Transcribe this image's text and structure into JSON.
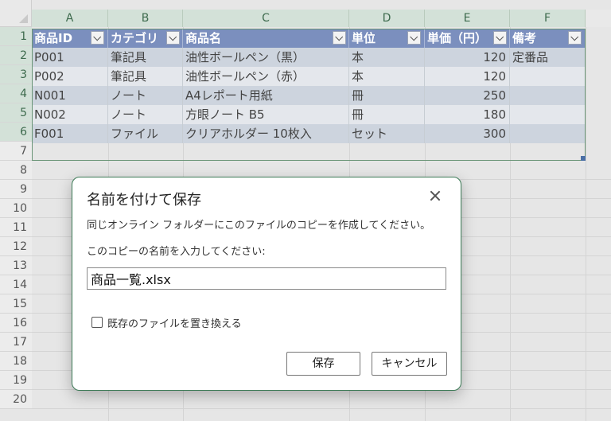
{
  "columns": [
    "A",
    "B",
    "C",
    "D",
    "E",
    "F"
  ],
  "rows": [
    "1",
    "2",
    "3",
    "4",
    "5",
    "6",
    "7",
    "8",
    "9",
    "10",
    "11",
    "12",
    "13",
    "14",
    "15",
    "16",
    "17",
    "18",
    "19",
    "20"
  ],
  "table": {
    "headers": [
      "商品ID",
      "カテゴリ",
      "商品名",
      "単位",
      "単価（円）",
      "備考"
    ],
    "rows": [
      [
        "P001",
        "筆記具",
        "油性ボールペン（黒）",
        "本",
        "120",
        "定番品"
      ],
      [
        "P002",
        "筆記具",
        "油性ボールペン（赤）",
        "本",
        "120",
        ""
      ],
      [
        "N001",
        "ノート",
        "A4レポート用紙",
        "冊",
        "250",
        ""
      ],
      [
        "N002",
        "ノート",
        "方眼ノート B5",
        "冊",
        "180",
        ""
      ],
      [
        "F001",
        "ファイル",
        "クリアホルダー 10枚入",
        "セット",
        "300",
        ""
      ]
    ],
    "colors": {
      "header": "#7b8fbe",
      "row_dark": "#cdd4de",
      "row_light": "#e4e7ec",
      "border": "#6a9577"
    }
  },
  "dialog": {
    "title": "名前を付けて保存",
    "message": "同じオンライン フォルダーにこのファイルのコピーを作成してください。",
    "prompt": "このコピーの名前を入力してください:",
    "filename": "商品一覧.xlsx",
    "checkbox_label": "既存のファイルを置き換える",
    "checkbox_checked": false,
    "save_label": "保存",
    "cancel_label": "キャンセル",
    "close_icon": "close-icon",
    "accent": "#3c7a56"
  }
}
